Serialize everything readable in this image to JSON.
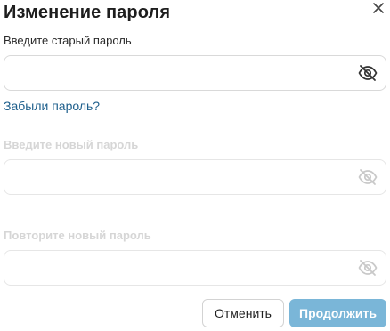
{
  "dialog": {
    "title": "Изменение пароля",
    "close_icon": "close-icon"
  },
  "old_password": {
    "label": "Введите старый пароль",
    "value": "",
    "eye_icon": "eye-off-icon",
    "enabled": true
  },
  "forgot_link": "Забыли пароль?",
  "new_password": {
    "label": "Введите новый пароль",
    "value": "",
    "eye_icon": "eye-off-icon",
    "enabled": false
  },
  "repeat_password": {
    "label": "Повторите новый пароль",
    "value": "",
    "eye_icon": "eye-off-icon",
    "enabled": false
  },
  "buttons": {
    "cancel": "Отменить",
    "continue": "Продолжить"
  },
  "colors": {
    "link": "#1e5f8c",
    "primary_button_disabled": "#7ab6d8",
    "icon_active": "#333333",
    "icon_disabled": "#c9c9c9"
  }
}
